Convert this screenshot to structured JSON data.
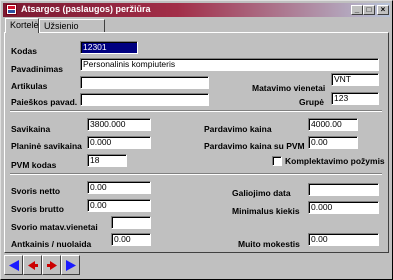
{
  "window": {
    "title": "Atsargos (paslaugos) peržiūra",
    "minimize": "_",
    "maximize": "□",
    "close": "×"
  },
  "tabs": [
    {
      "label": "Kortelė",
      "active": true
    },
    {
      "label": "Užsienio kalba",
      "active": false
    }
  ],
  "form": {
    "kodas": {
      "label": "Kodas",
      "value": "12301"
    },
    "pavadinimas": {
      "label": "Pavadinimas",
      "value": "Personalinis kompiuteris"
    },
    "artikulas": {
      "label": "Artikulas",
      "value": ""
    },
    "paieskos": {
      "label": "Paieškos pavad.",
      "value": ""
    },
    "matavimo": {
      "label": "Matavimo vienetai",
      "value": "VNT"
    },
    "grupe": {
      "label": "Grupė",
      "value": "123"
    },
    "savikaina": {
      "label": "Savikaina",
      "value": "3800.000"
    },
    "planine": {
      "label": "Planinė savikaina",
      "value": "0.000"
    },
    "pvm": {
      "label": "PVM kodas",
      "value": "18"
    },
    "pardavimo_kaina": {
      "label": "Pardavimo kaina",
      "value": "4000.00"
    },
    "pardavimo_pvm": {
      "label": "Pardavimo kaina su PVM",
      "value": "0.00"
    },
    "komplektavimo": {
      "label": "Komplektavimo požymis",
      "checked": false
    },
    "svoris_netto": {
      "label": "Svoris netto",
      "value": "0.00"
    },
    "svoris_brutto": {
      "label": "Svoris brutto",
      "value": "0.00"
    },
    "svorio_matav": {
      "label": "Svorio matav.vienetai",
      "value": ""
    },
    "antkainis": {
      "label": "Antkainis / nuolaida",
      "value": "0.00"
    },
    "galiojimo": {
      "label": "Galiojimo data",
      "value": ""
    },
    "minimalus": {
      "label": "Minimalus kiekis",
      "value": "0.000"
    },
    "muito": {
      "label": "Muito mokestis",
      "value": "0.00"
    }
  },
  "navigation": [
    {
      "name": "first",
      "icon": "first-record-icon"
    },
    {
      "name": "previous",
      "icon": "previous-record-icon"
    },
    {
      "name": "next",
      "icon": "next-record-icon"
    },
    {
      "name": "last",
      "icon": "last-record-icon"
    }
  ],
  "colors": {
    "title_start": "#7b1a32",
    "title_end": "#b7c3d9",
    "nav_blue": "#1a1aff",
    "nav_red": "#cc0000"
  }
}
